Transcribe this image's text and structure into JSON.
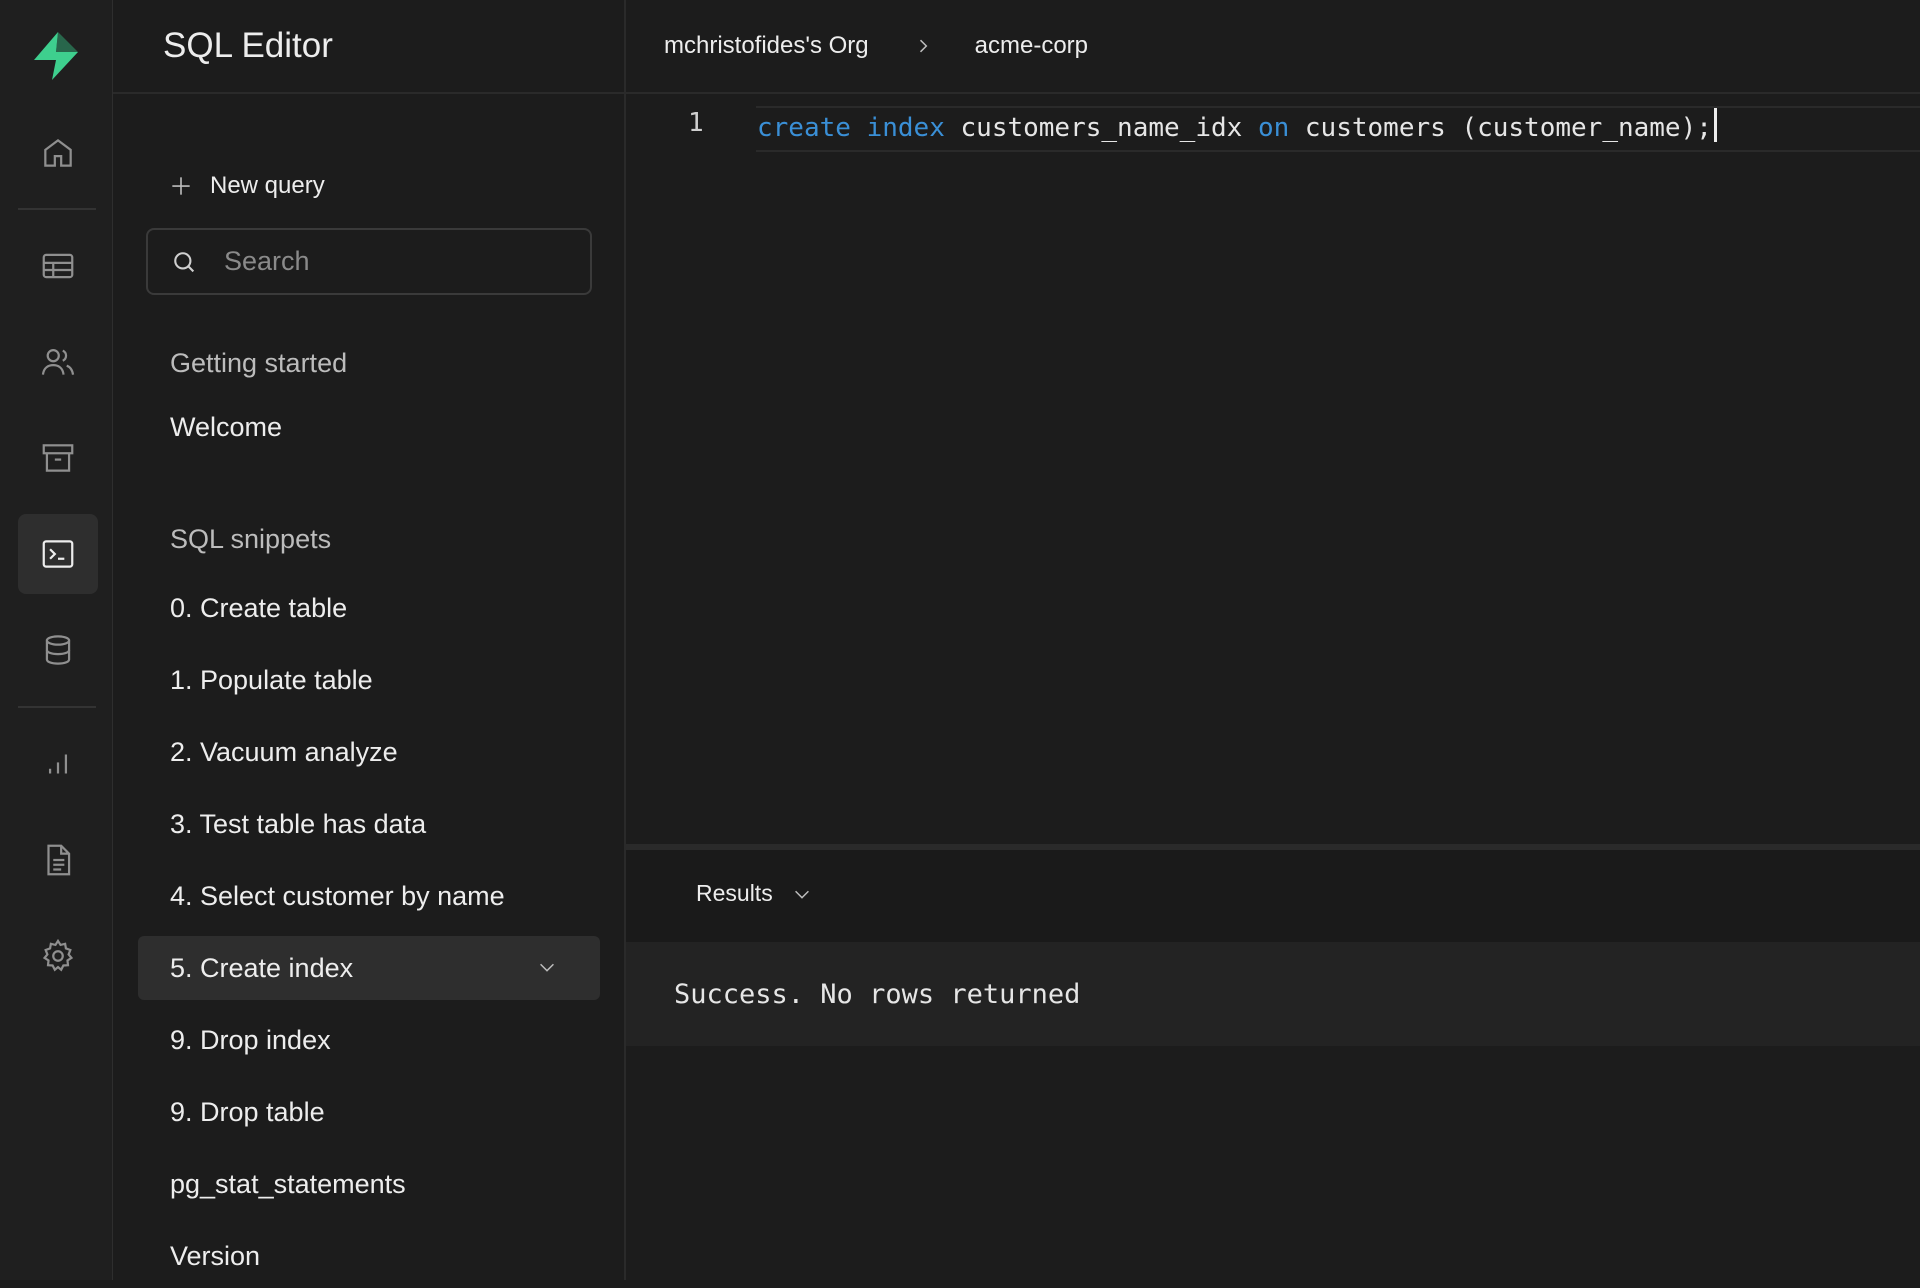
{
  "sidebar": {
    "title": "SQL Editor",
    "new_query_label": "New query",
    "search_placeholder": "Search",
    "getting_started_label": "Getting started",
    "welcome_label": "Welcome",
    "snippets_label": "SQL snippets",
    "snippets": [
      "0. Create table",
      "1. Populate table",
      "2. Vacuum analyze",
      "3. Test table has data",
      "4. Select customer by name",
      "5. Create index",
      "9. Drop index",
      "9. Drop table",
      "pg_stat_statements",
      "Version"
    ],
    "active_snippet": "5. Create index"
  },
  "breadcrumb": {
    "org": "mchristofides's Org",
    "project": "acme-corp"
  },
  "editor": {
    "line_number": "1",
    "kw1": "create",
    "kw2": "index",
    "part1": "customers_name_idx",
    "kw3": "on",
    "part2": "customers (customer_name);"
  },
  "results": {
    "tab_label": "Results",
    "message": "Success. No rows returned"
  },
  "colors": {
    "brand": "#3ecf8e",
    "keyword": "#3a8fd6",
    "background": "#1c1c1c"
  },
  "rail_icons": [
    "home-icon",
    "table-icon",
    "users-icon",
    "archive-icon",
    "terminal-icon",
    "database-icon",
    "chart-icon",
    "document-icon",
    "settings-icon"
  ]
}
